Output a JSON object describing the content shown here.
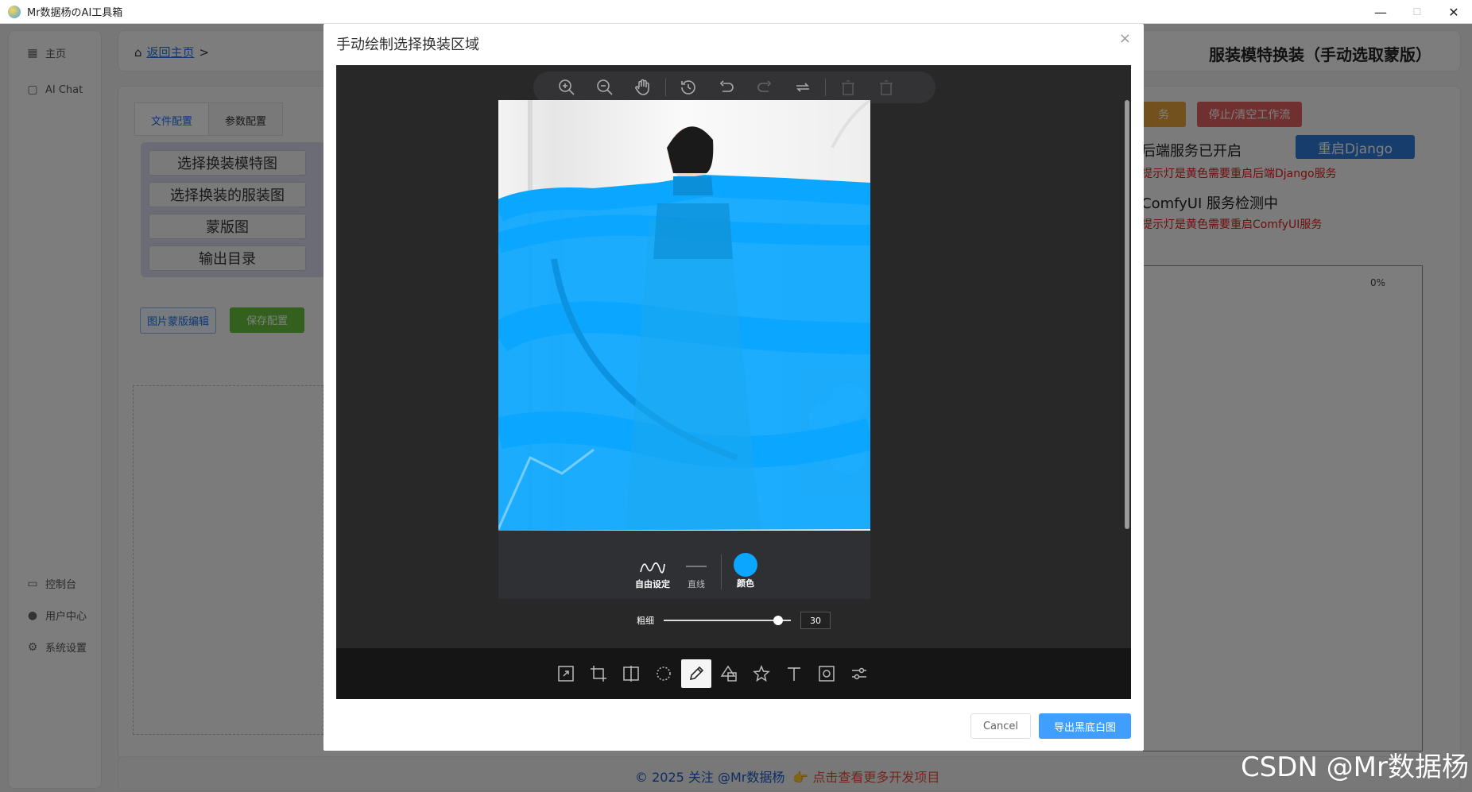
{
  "window": {
    "title": "Mr数据杨のAI工具箱",
    "controls": [
      "—",
      "☐",
      "✕"
    ]
  },
  "sidebar": {
    "items": [
      {
        "label": "主页",
        "icon": "grid-icon"
      },
      {
        "label": "AI Chat",
        "icon": "chat-icon"
      }
    ],
    "bottom_items": [
      {
        "label": "控制台",
        "icon": "monitor-icon"
      },
      {
        "label": "用户中心",
        "icon": "user-icon"
      },
      {
        "label": "系统设置",
        "icon": "gear-icon"
      }
    ]
  },
  "header": {
    "home_link": "返回主页",
    "separator": ">",
    "title": "服装模特换装（手动选取蒙版）"
  },
  "config": {
    "tabs": [
      "文件配置",
      "参数配置"
    ],
    "buttons": [
      "选择换装模特图",
      "选择换装的服装图",
      "蒙版图",
      "输出目录"
    ],
    "mask_edit_label": "图片蒙版编辑",
    "save_label": "保存配置"
  },
  "right_panel": {
    "service_btn": "务",
    "stop_btn": "停止/清空工作流",
    "backend_status": "后端服务已开启",
    "restart_django": "重启Django",
    "warn_django": "提示灯是黄色需要重启后端Django服务",
    "comfy_status": "ComfyUI 服务检测中",
    "warn_comfy": "提示灯是黄色需要重启ComfyUI服务",
    "progress": "0%"
  },
  "footer": {
    "copyright": "© 2025 关注 @Mr数据杨",
    "more_link": "👉 点击查看更多开发项目"
  },
  "watermark": "CSDN @Mr数据杨",
  "dialog": {
    "title": "手动绘制选择换装区域",
    "close": "×",
    "draw_modes": [
      {
        "label": "自由设定",
        "active": true
      },
      {
        "label": "直线",
        "active": false
      },
      {
        "label": "颜色",
        "active": true
      }
    ],
    "brush_color": "#0aa6ff",
    "thickness_label": "粗细",
    "thickness_value": "30",
    "thickness_fraction": 0.9,
    "cancel_label": "Cancel",
    "export_label": "导出黑底白图"
  }
}
